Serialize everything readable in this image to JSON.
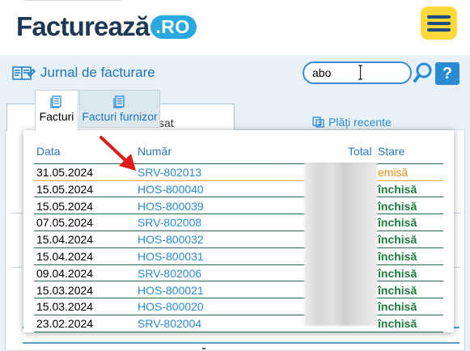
{
  "header": {
    "logo_text": "Facturează",
    "logo_badge": ".RO"
  },
  "page": {
    "title": "Jurnal de facturare"
  },
  "search": {
    "value": "abo",
    "help_label": "?"
  },
  "background_tabs": {
    "sat_label": "sat",
    "plati_label": "Plăți recente"
  },
  "dropdown": {
    "tabs": [
      {
        "label": "Facturi"
      },
      {
        "label": "Facturi furnizor"
      }
    ],
    "columns": {
      "data": "Data",
      "numar": "Număr",
      "total": "Total",
      "stare": "Stare"
    },
    "rows": [
      {
        "data": "31.05.2024",
        "numar": "SRV-802013",
        "stare": "emisă"
      },
      {
        "data": "15.05.2024",
        "numar": "HOS-800040",
        "stare": "închisă"
      },
      {
        "data": "15.05.2024",
        "numar": "HOS-800039",
        "stare": "închisă"
      },
      {
        "data": "07.05.2024",
        "numar": "SRV-802008",
        "stare": "închisă"
      },
      {
        "data": "15.04.2024",
        "numar": "HOS-800032",
        "stare": "închisă"
      },
      {
        "data": "15.04.2024",
        "numar": "HOS-800031",
        "stare": "închisă"
      },
      {
        "data": "09.04.2024",
        "numar": "SRV-802006",
        "stare": "închisă"
      },
      {
        "data": "15.03.2024",
        "numar": "HOS-800021",
        "stare": "închisă"
      },
      {
        "data": "15.03.2024",
        "numar": "HOS-800020",
        "stare": "închisă"
      },
      {
        "data": "23.02.2024",
        "numar": "SRV-802004",
        "stare": "închisă"
      }
    ]
  },
  "colors": {
    "brand_dark": "#1e3753",
    "brand_blue": "#2aa9e0",
    "menu_yellow": "#ffd93a",
    "link_blue": "#2a8bd2",
    "status_emisa": "#e58c16",
    "status_inchisa": "#1d7a3f"
  },
  "icons": [
    "menu-icon",
    "journal-icon",
    "search-icon",
    "text-cursor-icon",
    "invoice-icon",
    "supplier-invoice-icon",
    "payments-icon",
    "red-arrow"
  ]
}
